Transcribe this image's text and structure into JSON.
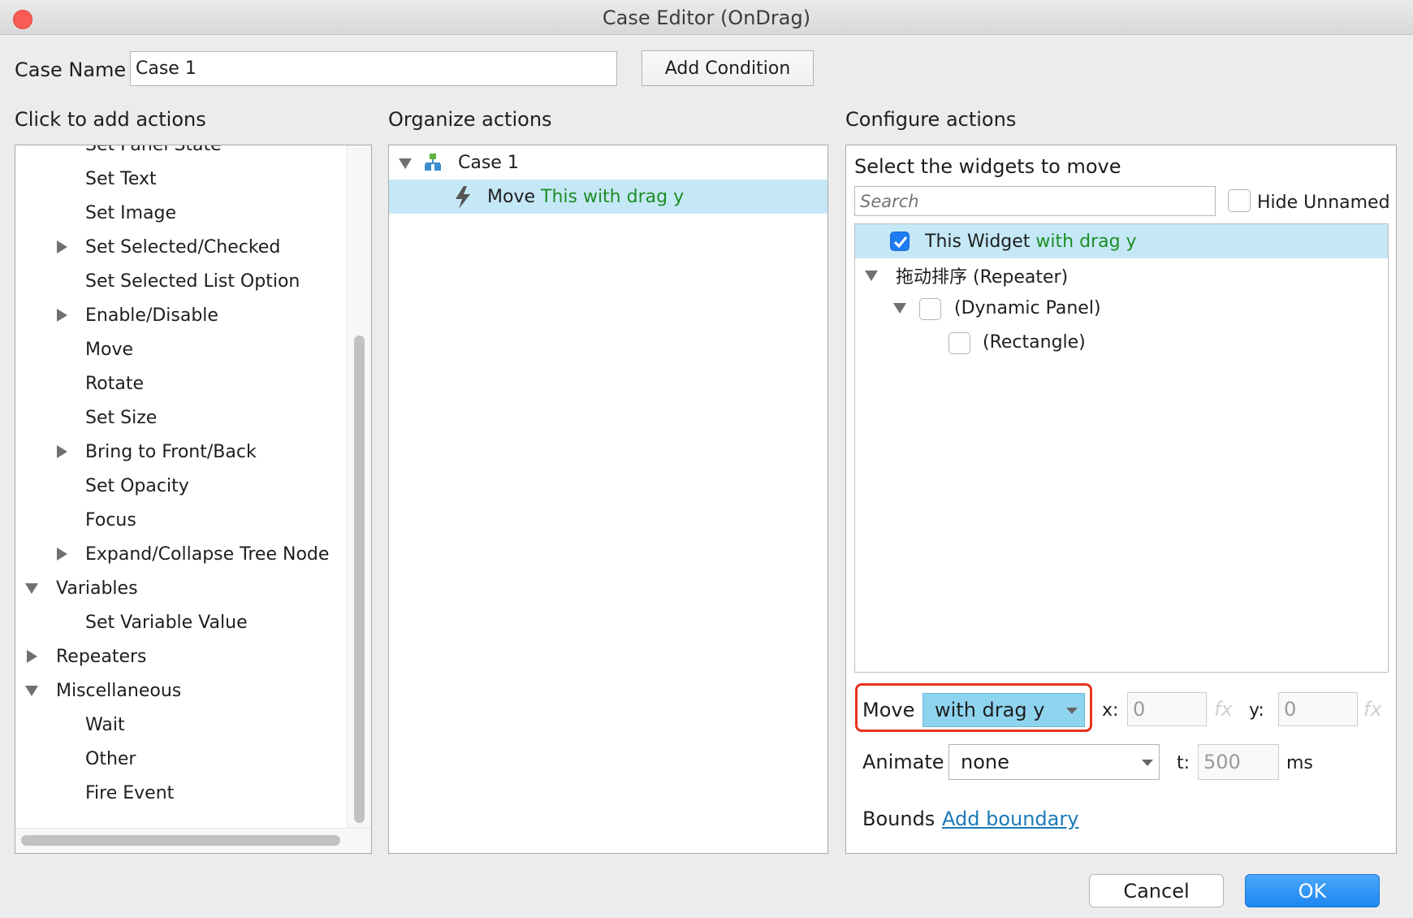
{
  "window": {
    "title": "Case Editor (OnDrag)"
  },
  "case_name": {
    "label": "Case Name",
    "value": "Case 1",
    "add_condition": "Add Condition"
  },
  "left": {
    "header": "Click to add actions",
    "items": [
      {
        "label": "Set Panel State"
      },
      {
        "label": "Set Text"
      },
      {
        "label": "Set Image"
      },
      {
        "label": "Set Selected/Checked"
      },
      {
        "label": "Set Selected List Option"
      },
      {
        "label": "Enable/Disable"
      },
      {
        "label": "Move"
      },
      {
        "label": "Rotate"
      },
      {
        "label": "Set Size"
      },
      {
        "label": "Bring to Front/Back"
      },
      {
        "label": "Set Opacity"
      },
      {
        "label": "Focus"
      },
      {
        "label": "Expand/Collapse Tree Node"
      },
      {
        "label": "Variables"
      },
      {
        "label": "Set Variable Value"
      },
      {
        "label": "Repeaters"
      },
      {
        "label": "Miscellaneous"
      },
      {
        "label": "Wait"
      },
      {
        "label": "Other"
      },
      {
        "label": "Fire Event"
      }
    ]
  },
  "middle": {
    "header": "Organize actions",
    "case_label": "Case 1",
    "action_prefix": "Move",
    "action_target": "This with drag y"
  },
  "right": {
    "header": "Configure actions",
    "widgets_title": "Select the widgets to move",
    "search_placeholder": "Search",
    "hide_unnamed": "Hide Unnamed",
    "tree": {
      "this_widget": "This Widget",
      "this_widget_suffix": "with drag y",
      "repeater": "拖动排序 (Repeater)",
      "dynamic_panel": "(Dynamic Panel)",
      "rectangle": "(Rectangle)"
    },
    "move_label": "Move",
    "move_value": "with drag y",
    "x_label": "x:",
    "x_value": "0",
    "y_label": "y:",
    "y_value": "0",
    "fx": "fx",
    "animate_label": "Animate",
    "animate_value": "none",
    "t_label": "t:",
    "t_value": "500",
    "ms_label": "ms",
    "bounds_label": "Bounds",
    "add_boundary": "Add boundary"
  },
  "footer": {
    "cancel": "Cancel",
    "ok": "OK"
  },
  "colors": {
    "selection": "#c5e8f7",
    "green_text": "#1d8d23",
    "highlight_border": "#e8331c",
    "ok_button": "#1e90f5",
    "link": "#1a7ab8"
  }
}
